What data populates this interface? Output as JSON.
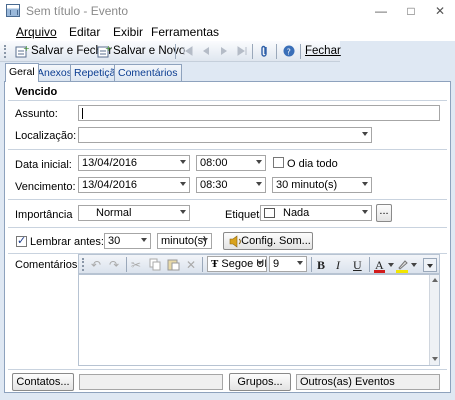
{
  "window": {
    "title": "Sem título - Evento",
    "minimize": "—",
    "maximize": "□",
    "close": "✕"
  },
  "menu": {
    "arquivo": "Arquivo",
    "editar": "Editar",
    "exibir": "Exibir",
    "ferramentas": "Ferramentas"
  },
  "toolbar": {
    "salvar_fechar": "Salvar e Fechar",
    "salvar_novo": "Salvar e Novo",
    "fechar": "Fechar"
  },
  "tabs": [
    "Geral",
    "Anexos",
    "Repetição",
    "Comentários"
  ],
  "form": {
    "header": "Vencido",
    "assunto_label": "Assunto:",
    "assunto_value": "",
    "localizacao_label": "Localização:",
    "localizacao_value": "",
    "data_inicial_label": "Data inicial:",
    "data_inicial_date": "13/04/2016",
    "data_inicial_time": "08:00",
    "dia_todo_label": "O dia todo",
    "vencimento_label": "Vencimento:",
    "vencimento_date": "13/04/2016",
    "vencimento_time": "08:30",
    "duracao": "30 minuto(s)",
    "importancia_label": "Importância",
    "importancia_value": "Normal",
    "etiqueta_label": "Etiqueta:",
    "etiqueta_value": "Nada",
    "etiqueta_more": "...",
    "lembrar_label": "Lembrar antes:",
    "lembrar_checked": true,
    "lembrar_value": "30",
    "lembrar_unit": "minuto(s)",
    "config_som": "Config. Som...",
    "comentarios_label": "Comentários:",
    "font_name": "Segoe UI",
    "font_size": "9",
    "bold": "B",
    "italic": "I",
    "underline": "U",
    "font_color": "A"
  },
  "footer": {
    "contatos": "Contatos...",
    "contatos_value": "",
    "grupos": "Grupos...",
    "outros": "Outros(as) Eventos"
  },
  "colors": {
    "accent": "#0a3d91",
    "window_bg": "#dfe8f3"
  }
}
